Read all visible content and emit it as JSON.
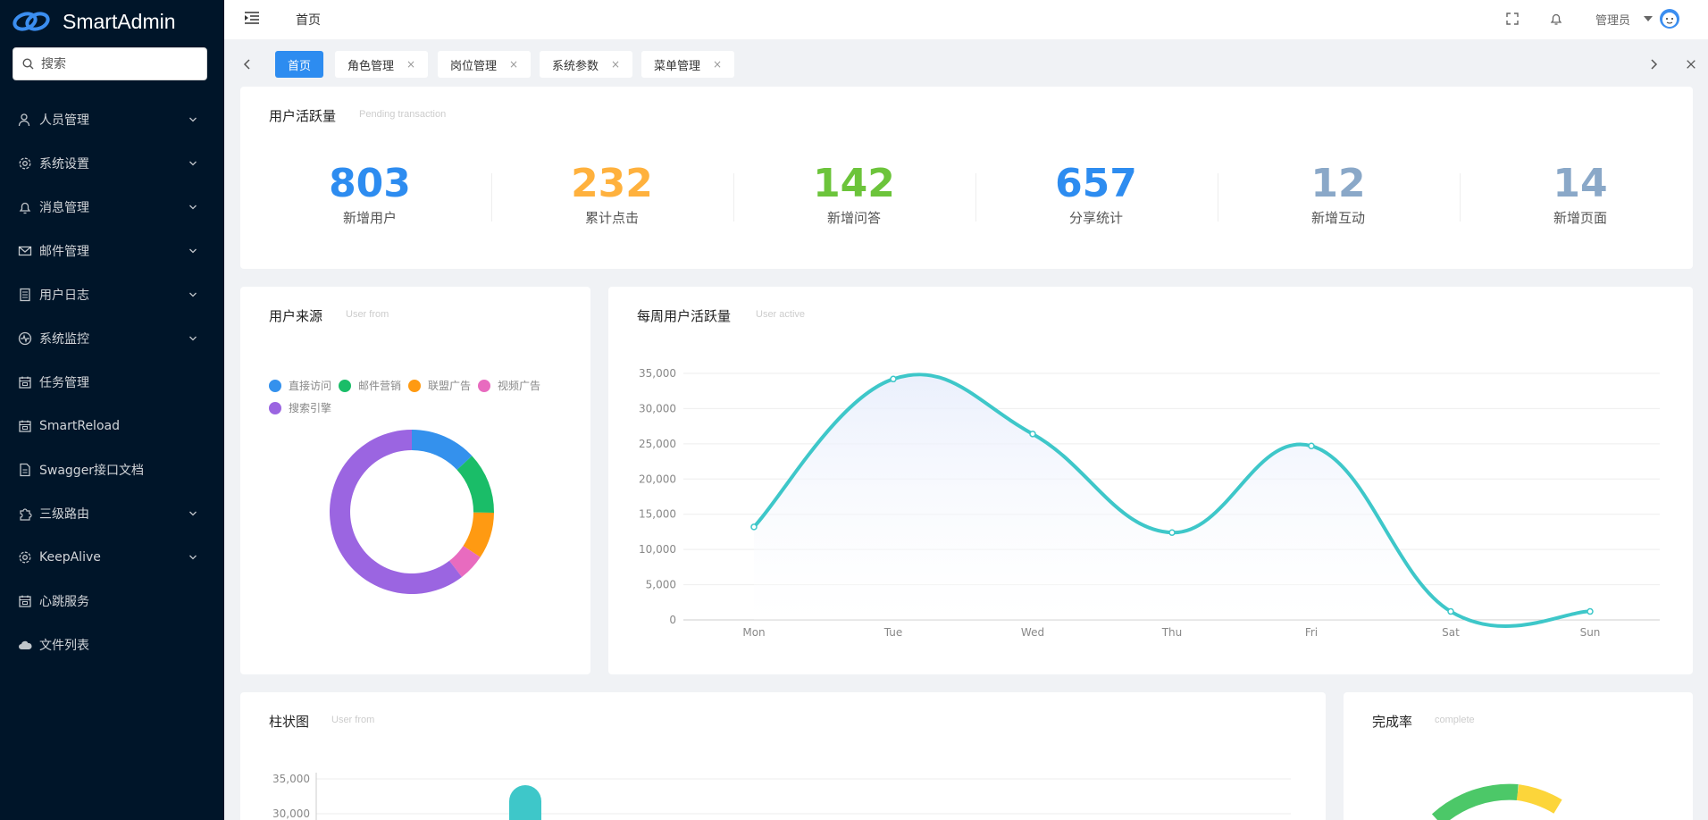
{
  "app": {
    "name": "SmartAdmin"
  },
  "search": {
    "placeholder": "搜索"
  },
  "sidebar": {
    "items": [
      {
        "label": "人员管理",
        "icon": "user-icon",
        "expandable": true
      },
      {
        "label": "系统设置",
        "icon": "gear-icon",
        "expandable": true
      },
      {
        "label": "消息管理",
        "icon": "bell-icon",
        "expandable": true
      },
      {
        "label": "邮件管理",
        "icon": "mail-icon",
        "expandable": true
      },
      {
        "label": "用户日志",
        "icon": "log-icon",
        "expandable": true
      },
      {
        "label": "系统监控",
        "icon": "monitor-icon",
        "expandable": true
      },
      {
        "label": "任务管理",
        "icon": "calendar-icon",
        "expandable": false
      },
      {
        "label": "SmartReload",
        "icon": "calendar-icon",
        "expandable": false
      },
      {
        "label": "Swagger接口文档",
        "icon": "document-icon",
        "expandable": false
      },
      {
        "label": "三级路由",
        "icon": "puzzle-icon",
        "expandable": true
      },
      {
        "label": "KeepAlive",
        "icon": "gear-icon",
        "expandable": true
      },
      {
        "label": "心跳服务",
        "icon": "calendar-icon",
        "expandable": false
      },
      {
        "label": "文件列表",
        "icon": "cloud-icon",
        "expandable": false
      }
    ]
  },
  "header": {
    "breadcrumb": "首页",
    "user": "管理员"
  },
  "tabs": [
    {
      "label": "首页",
      "active": true,
      "closable": false
    },
    {
      "label": "角色管理",
      "active": false,
      "closable": true
    },
    {
      "label": "岗位管理",
      "active": false,
      "closable": true
    },
    {
      "label": "系统参数",
      "active": false,
      "closable": true
    },
    {
      "label": "菜单管理",
      "active": false,
      "closable": true
    }
  ],
  "tab_close_glyph": "×",
  "activity": {
    "title": "用户活跃量",
    "subtitle": "Pending transaction",
    "stats": [
      {
        "value": "803",
        "label": "新增用户",
        "color": "#2d8cf0"
      },
      {
        "value": "232",
        "label": "累计点击",
        "color": "#ffb13d"
      },
      {
        "value": "142",
        "label": "新增问答",
        "color": "#6cc43b"
      },
      {
        "value": "657",
        "label": "分享统计",
        "color": "#2d8cf0"
      },
      {
        "value": "12",
        "label": "新增互动",
        "color": "#8aa8c8"
      },
      {
        "value": "14",
        "label": "新增页面",
        "color": "#8aa8c8"
      }
    ]
  },
  "source": {
    "title": "用户来源",
    "subtitle": "User from"
  },
  "weekly": {
    "title": "每周用户活跃量",
    "subtitle": "User active"
  },
  "bar": {
    "title": "柱状图",
    "subtitle": "User from"
  },
  "completion": {
    "title": "完成率",
    "subtitle": "complete"
  },
  "chart_data": [
    {
      "type": "pie",
      "labels": [
        "直接访问",
        "邮件营销",
        "联盟广告",
        "视频广告",
        "搜索引擎"
      ],
      "values": [
        335,
        310,
        234,
        135,
        1548
      ],
      "colors": [
        "#3491ed",
        "#1abd68",
        "#ff9a12",
        "#e86bbf",
        "#9b65e1"
      ]
    },
    {
      "type": "area",
      "categories": [
        "Mon",
        "Tue",
        "Wed",
        "Thu",
        "Fri",
        "Sat",
        "Sun"
      ],
      "values": [
        13200,
        34200,
        26400,
        12400,
        24700,
        1200,
        1200
      ],
      "ylim": [
        0,
        35000
      ],
      "yticks": [
        "35,000",
        "30,000",
        "25,000",
        "20,000",
        "15,000",
        "10,000",
        "5,000",
        "0"
      ],
      "color": "#3ec7c9"
    },
    {
      "type": "bar",
      "yticks": [
        "35,000",
        "30,000"
      ],
      "color": "#3ec7c9"
    }
  ]
}
